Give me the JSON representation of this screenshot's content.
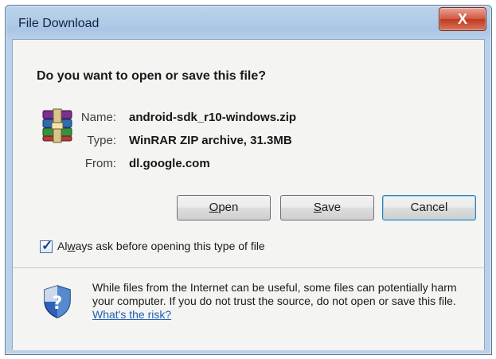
{
  "window": {
    "title": "File Download",
    "close_glyph": "X"
  },
  "dialog": {
    "question": "Do you want to open or save this file?",
    "file": {
      "icon": "winrar-archive-icon",
      "name_label": "Name:",
      "name_value": "android-sdk_r10-windows.zip",
      "type_label": "Type:",
      "type_value": "WinRAR ZIP archive, 31.3MB",
      "from_label": "From:",
      "from_value": "dl.google.com"
    },
    "buttons": {
      "open_prefix": "O",
      "open_rest": "pen",
      "save_prefix": "S",
      "save_rest": "ave",
      "cancel": "Cancel"
    },
    "checkbox": {
      "checked": true,
      "label_prefix": "Al",
      "label_underlined": "w",
      "label_rest": "ays ask before opening this type of file"
    },
    "warning": {
      "icon": "security-shield-icon",
      "text": "While files from the Internet can be useful, some files can potentially harm your computer. If you do not trust the source, do not open or save this file.",
      "link": "What's the risk?"
    }
  },
  "colors": {
    "title_bar": "#b9d1ea",
    "close_button": "#c0371f",
    "link": "#1f5fb4",
    "default_button_border": "#3c7fb1"
  }
}
